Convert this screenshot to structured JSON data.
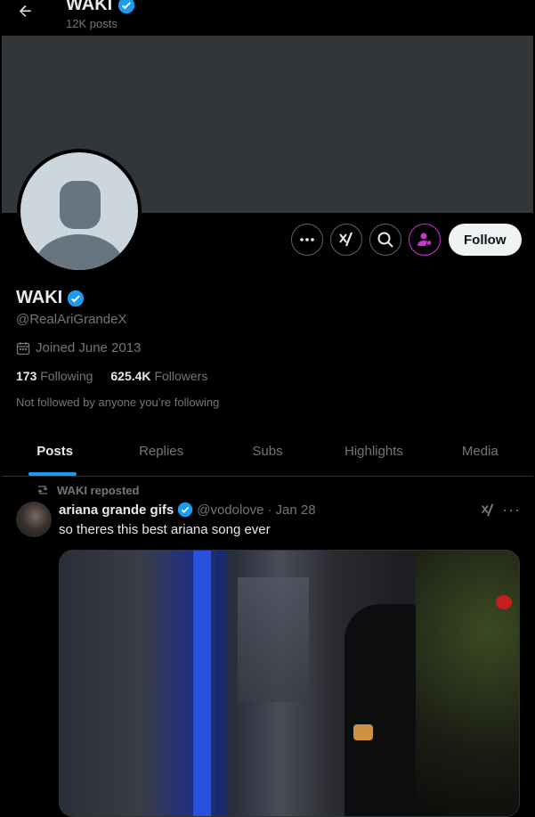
{
  "header": {
    "title": "WAKI",
    "posts_count": "12K posts"
  },
  "profile": {
    "name": "WAKI",
    "handle": "@RealAriGrandeX",
    "joined": "Joined June 2013",
    "following_count": "173",
    "following_label": "Following",
    "followers_count": "625.4K",
    "followers_label": "Followers",
    "not_followed_text": "Not followed by anyone you’re following",
    "follow_label": "Follow"
  },
  "tabs": [
    {
      "label": "Posts"
    },
    {
      "label": "Replies"
    },
    {
      "label": "Subs"
    },
    {
      "label": "Highlights"
    },
    {
      "label": "Media"
    }
  ],
  "post": {
    "repost_text": "WAKI reposted",
    "author_name": "ariana grande gifs",
    "author_handle": "@vodolove",
    "separator": "·",
    "date": "Jan 28",
    "text": "so theres this best ariana song ever",
    "more": "···"
  },
  "colors": {
    "accent": "#1d9bf0",
    "verified": "#1d9bf0",
    "subscribe": "#c936cc",
    "banner": "#333639"
  },
  "icons": [
    "back-arrow-icon",
    "verified-icon",
    "more-icon",
    "grok-icon",
    "search-icon",
    "subscribe-icon",
    "calendar-icon",
    "repost-icon"
  ]
}
